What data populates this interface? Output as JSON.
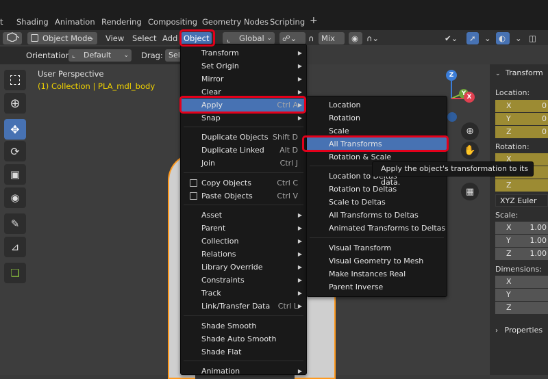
{
  "workspace_tabs": [
    "t",
    "Shading",
    "Animation",
    "Rendering",
    "Compositing",
    "Geometry Nodes",
    "Scripting",
    "+"
  ],
  "header": {
    "mode": "Object Mode",
    "menus": [
      "View",
      "Select",
      "Add",
      "Object"
    ],
    "transform": "Global",
    "snap": "Mix"
  },
  "subheader": {
    "orientation_label": "Orientation:",
    "orientation_value": "Default",
    "drag_label": "Drag:",
    "drag_value": "Sel"
  },
  "viewport": {
    "perspective": "User Perspective",
    "collection": "(1) Collection | PLA_mdl_body"
  },
  "object_menu": [
    {
      "label": "Transform",
      "shortcut": "",
      "submenu": true
    },
    {
      "label": "Set Origin",
      "shortcut": "",
      "submenu": true
    },
    {
      "label": "Mirror",
      "shortcut": "",
      "submenu": true
    },
    {
      "label": "Clear",
      "shortcut": "",
      "submenu": true
    },
    {
      "label": "Apply",
      "shortcut": "Ctrl A",
      "submenu": true
    },
    {
      "label": "Snap",
      "shortcut": "",
      "submenu": true
    },
    {
      "label": "Duplicate Objects",
      "shortcut": "Shift D",
      "submenu": false
    },
    {
      "label": "Duplicate Linked",
      "shortcut": "Alt D",
      "submenu": false
    },
    {
      "label": "Join",
      "shortcut": "Ctrl J",
      "submenu": false
    },
    {
      "label": "Copy Objects",
      "shortcut": "Ctrl C",
      "submenu": false
    },
    {
      "label": "Paste Objects",
      "shortcut": "Ctrl V",
      "submenu": false
    },
    {
      "label": "Asset",
      "shortcut": "",
      "submenu": true
    },
    {
      "label": "Parent",
      "shortcut": "",
      "submenu": true
    },
    {
      "label": "Collection",
      "shortcut": "",
      "submenu": true
    },
    {
      "label": "Relations",
      "shortcut": "",
      "submenu": true
    },
    {
      "label": "Library Override",
      "shortcut": "",
      "submenu": true
    },
    {
      "label": "Constraints",
      "shortcut": "",
      "submenu": true
    },
    {
      "label": "Track",
      "shortcut": "",
      "submenu": true
    },
    {
      "label": "Link/Transfer Data",
      "shortcut": "Ctrl L",
      "submenu": true
    },
    {
      "label": "Shade Smooth",
      "shortcut": "",
      "submenu": false
    },
    {
      "label": "Shade Auto Smooth",
      "shortcut": "",
      "submenu": false
    },
    {
      "label": "Shade Flat",
      "shortcut": "",
      "submenu": false
    },
    {
      "label": "Animation",
      "shortcut": "",
      "submenu": true
    }
  ],
  "apply_menu": [
    "Location",
    "Rotation",
    "Scale",
    "All Transforms",
    "Rotation & Scale",
    "Location to Deltas",
    "Rotation to Deltas",
    "Scale to Deltas",
    "All Transforms to Deltas",
    "Animated Transforms to Deltas",
    "Visual Transform",
    "Visual Geometry to Mesh",
    "Make Instances Real",
    "Parent Inverse"
  ],
  "tooltip": "Apply the object's transformation to its data.",
  "sidebar": {
    "header": "Transform",
    "location_label": "Location:",
    "location": [
      {
        "axis": "X",
        "value": "0"
      },
      {
        "axis": "Y",
        "value": "0"
      },
      {
        "axis": "Z",
        "value": "0"
      }
    ],
    "rotation_label": "Rotation:",
    "rotation_axes": [
      "X",
      "Y",
      "Z"
    ],
    "rotation_mode": "XYZ Euler",
    "scale_label": "Scale:",
    "scale": [
      {
        "axis": "X",
        "value": "1.00"
      },
      {
        "axis": "Y",
        "value": "1.00"
      },
      {
        "axis": "Z",
        "value": "1.00"
      }
    ],
    "dimensions_label": "Dimensions:",
    "dimensions_axes": [
      "X",
      "Y",
      "Z"
    ],
    "properties_label": "Properties"
  },
  "gizmo": {
    "z": "Z",
    "y": "Y",
    "x": "X"
  },
  "colors": {
    "accent": "#4772b3",
    "highlight": "#e3001b",
    "field_yellow": "#9c8b33",
    "menu_bg": "#191919"
  }
}
